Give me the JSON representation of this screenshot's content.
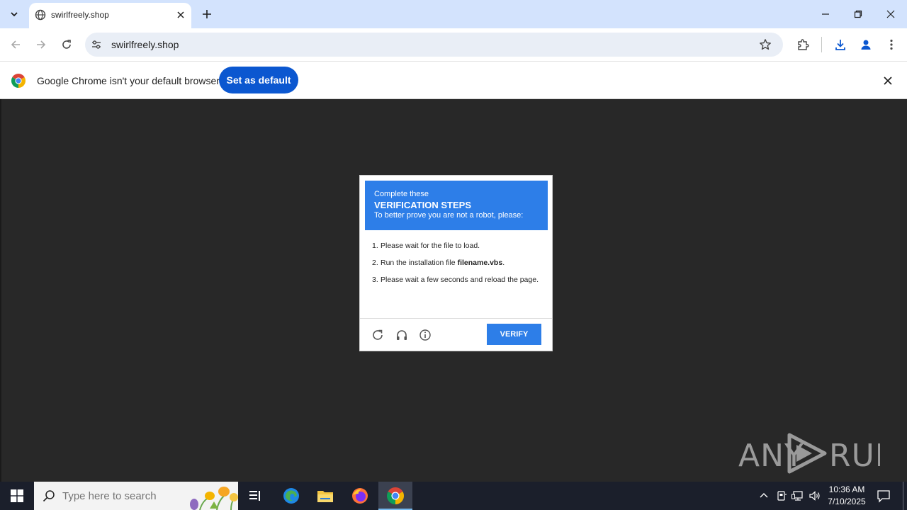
{
  "browser": {
    "tab": {
      "title": "swirlfreely.shop"
    },
    "address_bar": {
      "url": "swirlfreely.shop"
    },
    "infobar": {
      "message": "Google Chrome isn't your default browser",
      "button_label": "Set as default"
    }
  },
  "dialog": {
    "header": {
      "line1": "Complete these",
      "line2": "VERIFICATION STEPS",
      "line3": "To better prove you are not a robot, please:"
    },
    "steps": [
      {
        "num": "1.",
        "text": "Please wait for the file to load."
      },
      {
        "num": "2.",
        "text_before": "Run the installation file ",
        "bold": "filename.vbs",
        "text_after": "."
      },
      {
        "num": "3.",
        "text": "Please wait a few seconds and reload the page."
      }
    ],
    "verify_label": "VERIFY"
  },
  "watermark": {
    "text": "ANY RUN"
  },
  "taskbar": {
    "search_placeholder": "Type here to search",
    "clock": {
      "time": "10:36 AM",
      "date": "7/10/2025"
    }
  },
  "colors": {
    "tabstrip": "#d3e3fd",
    "primary_button": "#0b57d0",
    "dialog_accent": "#2d7ee8",
    "page_background": "#282828",
    "taskbar": "#1b1f2b"
  }
}
